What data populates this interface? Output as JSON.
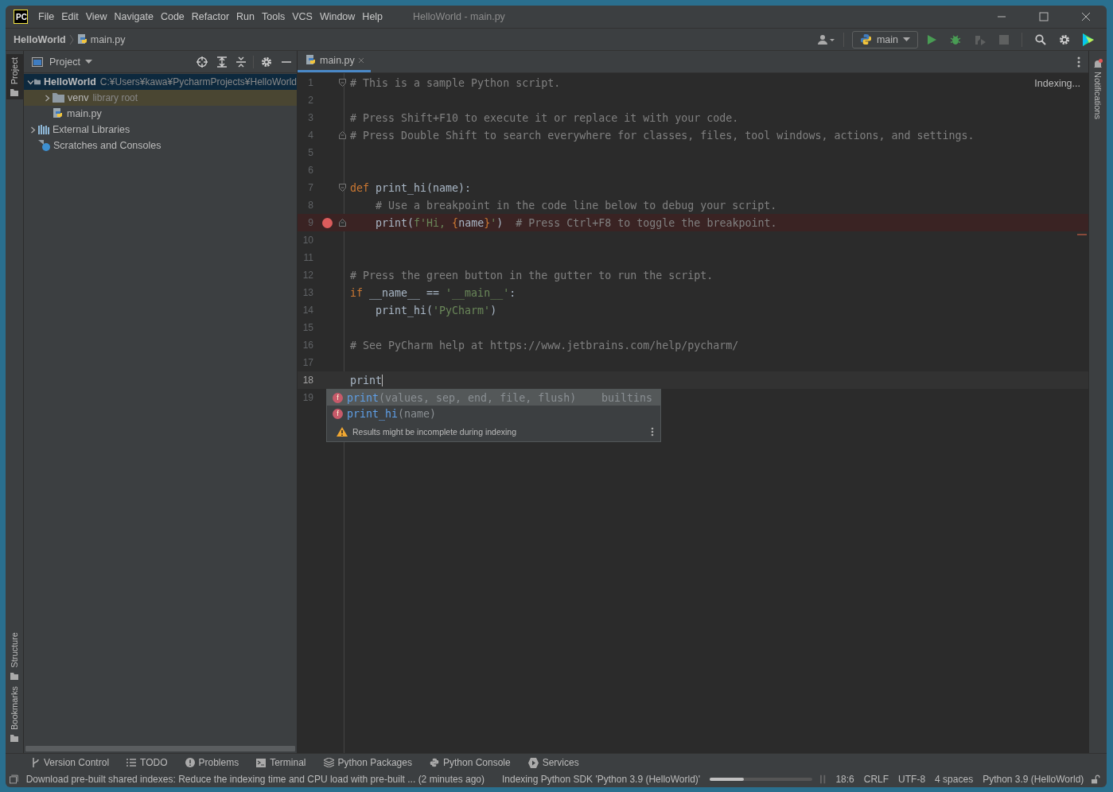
{
  "title_bar": {
    "logo": "PC",
    "menu": [
      "File",
      "Edit",
      "View",
      "Navigate",
      "Code",
      "Refactor",
      "Run",
      "Tools",
      "VCS",
      "Window",
      "Help"
    ],
    "title": "HelloWorld - main.py"
  },
  "nav_bar": {
    "breadcrumbs": [
      "HelloWorld",
      "main.py"
    ],
    "run_config": "main"
  },
  "left_stripe": [
    {
      "label": "Project",
      "selected": true
    },
    {
      "label": "Structure",
      "selected": false
    },
    {
      "label": "Bookmarks",
      "selected": false
    }
  ],
  "project_panel": {
    "title": "Project",
    "tree": [
      {
        "label": "HelloWorld",
        "hint": "C:¥Users¥kawa¥PycharmProjects¥HelloWorld",
        "kind": "project",
        "expanded": true,
        "selected": true,
        "children": [
          {
            "label": "venv",
            "hint": "library root",
            "kind": "library",
            "expanded": false,
            "selected": false
          },
          {
            "label": "main.py",
            "kind": "file",
            "selected": false
          }
        ]
      },
      {
        "label": "External Libraries",
        "kind": "libraries",
        "expanded": false,
        "selected": false
      },
      {
        "label": "Scratches and Consoles",
        "kind": "scratches",
        "selected": false
      }
    ]
  },
  "editor": {
    "tab": {
      "label": "main.py",
      "selected": true
    },
    "status": "Indexing...",
    "lines": [
      {
        "number": "1",
        "fold_start": true,
        "tokens": [
          {
            "kind": "comment",
            "text": "# This is a sample Python script."
          }
        ]
      },
      {
        "number": "2"
      },
      {
        "number": "3",
        "tokens": [
          {
            "kind": "comment",
            "text": "# Press Shift+F10 to execute it or replace it with your code."
          }
        ]
      },
      {
        "number": "4",
        "fold_end": true,
        "tokens": [
          {
            "kind": "comment",
            "text": "# Press Double Shift to search everywhere for classes, files, tool windows, actions, and settings."
          }
        ]
      },
      {
        "number": "5"
      },
      {
        "number": "6"
      },
      {
        "number": "7",
        "fold_start": true,
        "tokens": [
          {
            "kind": "keyword",
            "text": "def"
          },
          {
            "kind": "code",
            "text": " print_hi(name):"
          }
        ]
      },
      {
        "number": "8",
        "tokens": [
          {
            "kind": "comment",
            "text": "    # Use a breakpoint in the code line below to debug your script."
          }
        ]
      },
      {
        "number": "9",
        "fold_end": true,
        "breakpoint": true,
        "tokens": [
          {
            "kind": "code",
            "text": "    print("
          },
          {
            "kind": "string",
            "text": "f'Hi, "
          },
          {
            "kind": "brace",
            "text": "{"
          },
          {
            "kind": "code",
            "text": "name"
          },
          {
            "kind": "brace",
            "text": "}"
          },
          {
            "kind": "string",
            "text": "'"
          },
          {
            "kind": "code",
            "text": ")  "
          },
          {
            "kind": "comment",
            "text": "# Press Ctrl+F8 to toggle the breakpoint."
          }
        ]
      },
      {
        "number": "10"
      },
      {
        "number": "11"
      },
      {
        "number": "12",
        "tokens": [
          {
            "kind": "comment",
            "text": "# Press the green button in the gutter to run the script."
          }
        ]
      },
      {
        "number": "13",
        "tokens": [
          {
            "kind": "keyword",
            "text": "if"
          },
          {
            "kind": "code",
            "text": " __name__ == "
          },
          {
            "kind": "string",
            "text": "'__main__'"
          },
          {
            "kind": "code",
            "text": ":"
          }
        ]
      },
      {
        "number": "14",
        "tokens": [
          {
            "kind": "code",
            "text": "    print_hi("
          },
          {
            "kind": "string",
            "text": "'PyCharm'"
          },
          {
            "kind": "code",
            "text": ")"
          }
        ]
      },
      {
        "number": "15"
      },
      {
        "number": "16",
        "tokens": [
          {
            "kind": "comment",
            "text": "# See PyCharm help at https://www.jetbrains.com/help/pycharm/"
          }
        ]
      },
      {
        "number": "17"
      },
      {
        "number": "18",
        "current": true,
        "tokens": [
          {
            "kind": "code",
            "text": "print"
          }
        ]
      },
      {
        "number": "19"
      }
    ],
    "completion": {
      "items": [
        {
          "badge": "f",
          "name": "print",
          "params": "(values, sep, end, file, flush)",
          "source": "builtins",
          "selected": true
        },
        {
          "badge": "f",
          "name": "print_hi",
          "params": "(name)",
          "selected": false
        }
      ],
      "note": "Results might be incomplete during indexing"
    }
  },
  "right_stripe": {
    "label": "Notifications"
  },
  "tool_tabs": [
    {
      "kind": "vcs",
      "label": "Version Control"
    },
    {
      "kind": "todo",
      "label": "TODO"
    },
    {
      "kind": "problems",
      "label": "Problems"
    },
    {
      "kind": "terminal",
      "label": "Terminal"
    },
    {
      "kind": "packages",
      "label": "Python Packages"
    },
    {
      "kind": "console",
      "label": "Python Console"
    },
    {
      "kind": "services",
      "label": "Services"
    }
  ],
  "status_bar": {
    "message": "Download pre-built shared indexes: Reduce the indexing time and CPU load with pre-built ... (2 minutes ago)",
    "progress": {
      "label": "Indexing Python SDK 'Python 3.9 (HelloWorld)'",
      "level": 0.33
    },
    "items": [
      "18:6",
      "CRLF",
      "UTF-8",
      "4 spaces",
      "Python 3.9 (HelloWorld)"
    ]
  }
}
